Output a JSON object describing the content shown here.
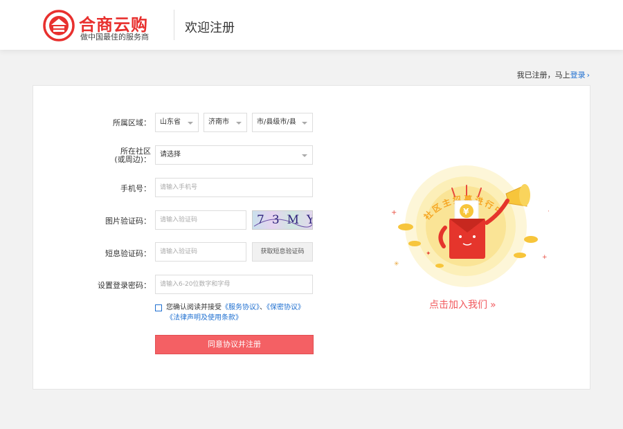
{
  "header": {
    "brand_name": "合商云购",
    "brand_slogan": "做中国最佳的服务商",
    "page_title": "欢迎注册"
  },
  "login_hint": {
    "text": "我已注册，马上",
    "link": "登录",
    "chevron": "›"
  },
  "form": {
    "region": {
      "label": "所属区域：",
      "province": "山东省",
      "city": "济南市",
      "county": "市/县级市/县"
    },
    "community": {
      "label_line1": "所在社区",
      "label_line2": "(或周边)：",
      "value": "请选择"
    },
    "phone": {
      "label": "手机号：",
      "placeholder": "请输入手机号"
    },
    "image_code": {
      "label": "图片验证码：",
      "placeholder": "请输入验证码",
      "captcha_text": "73MY"
    },
    "sms_code": {
      "label": "短息验证码：",
      "placeholder": "请输入验证码",
      "button": "获取短息验证码"
    },
    "password": {
      "label": "设置登录密码：",
      "placeholder": "请输入6-20位数字和字母"
    },
    "agreement": {
      "prefix": "您确认阅读并接受",
      "service": "《服务协议》",
      "separator": "、",
      "privacy": "《保密协议》",
      "legal": "《法律声明及使用条款》",
      "checked": false
    },
    "submit": "同意协议并注册"
  },
  "promo": {
    "banner": "社区主招募进行中",
    "coin_symbol": "¥",
    "cta": "点击加入我们",
    "cta_chevron": "»"
  },
  "colors": {
    "brand_red": "#e8302e",
    "link_blue": "#1e6fd0",
    "button_red": "#f46064",
    "promo_yellow": "#f7c53b"
  }
}
